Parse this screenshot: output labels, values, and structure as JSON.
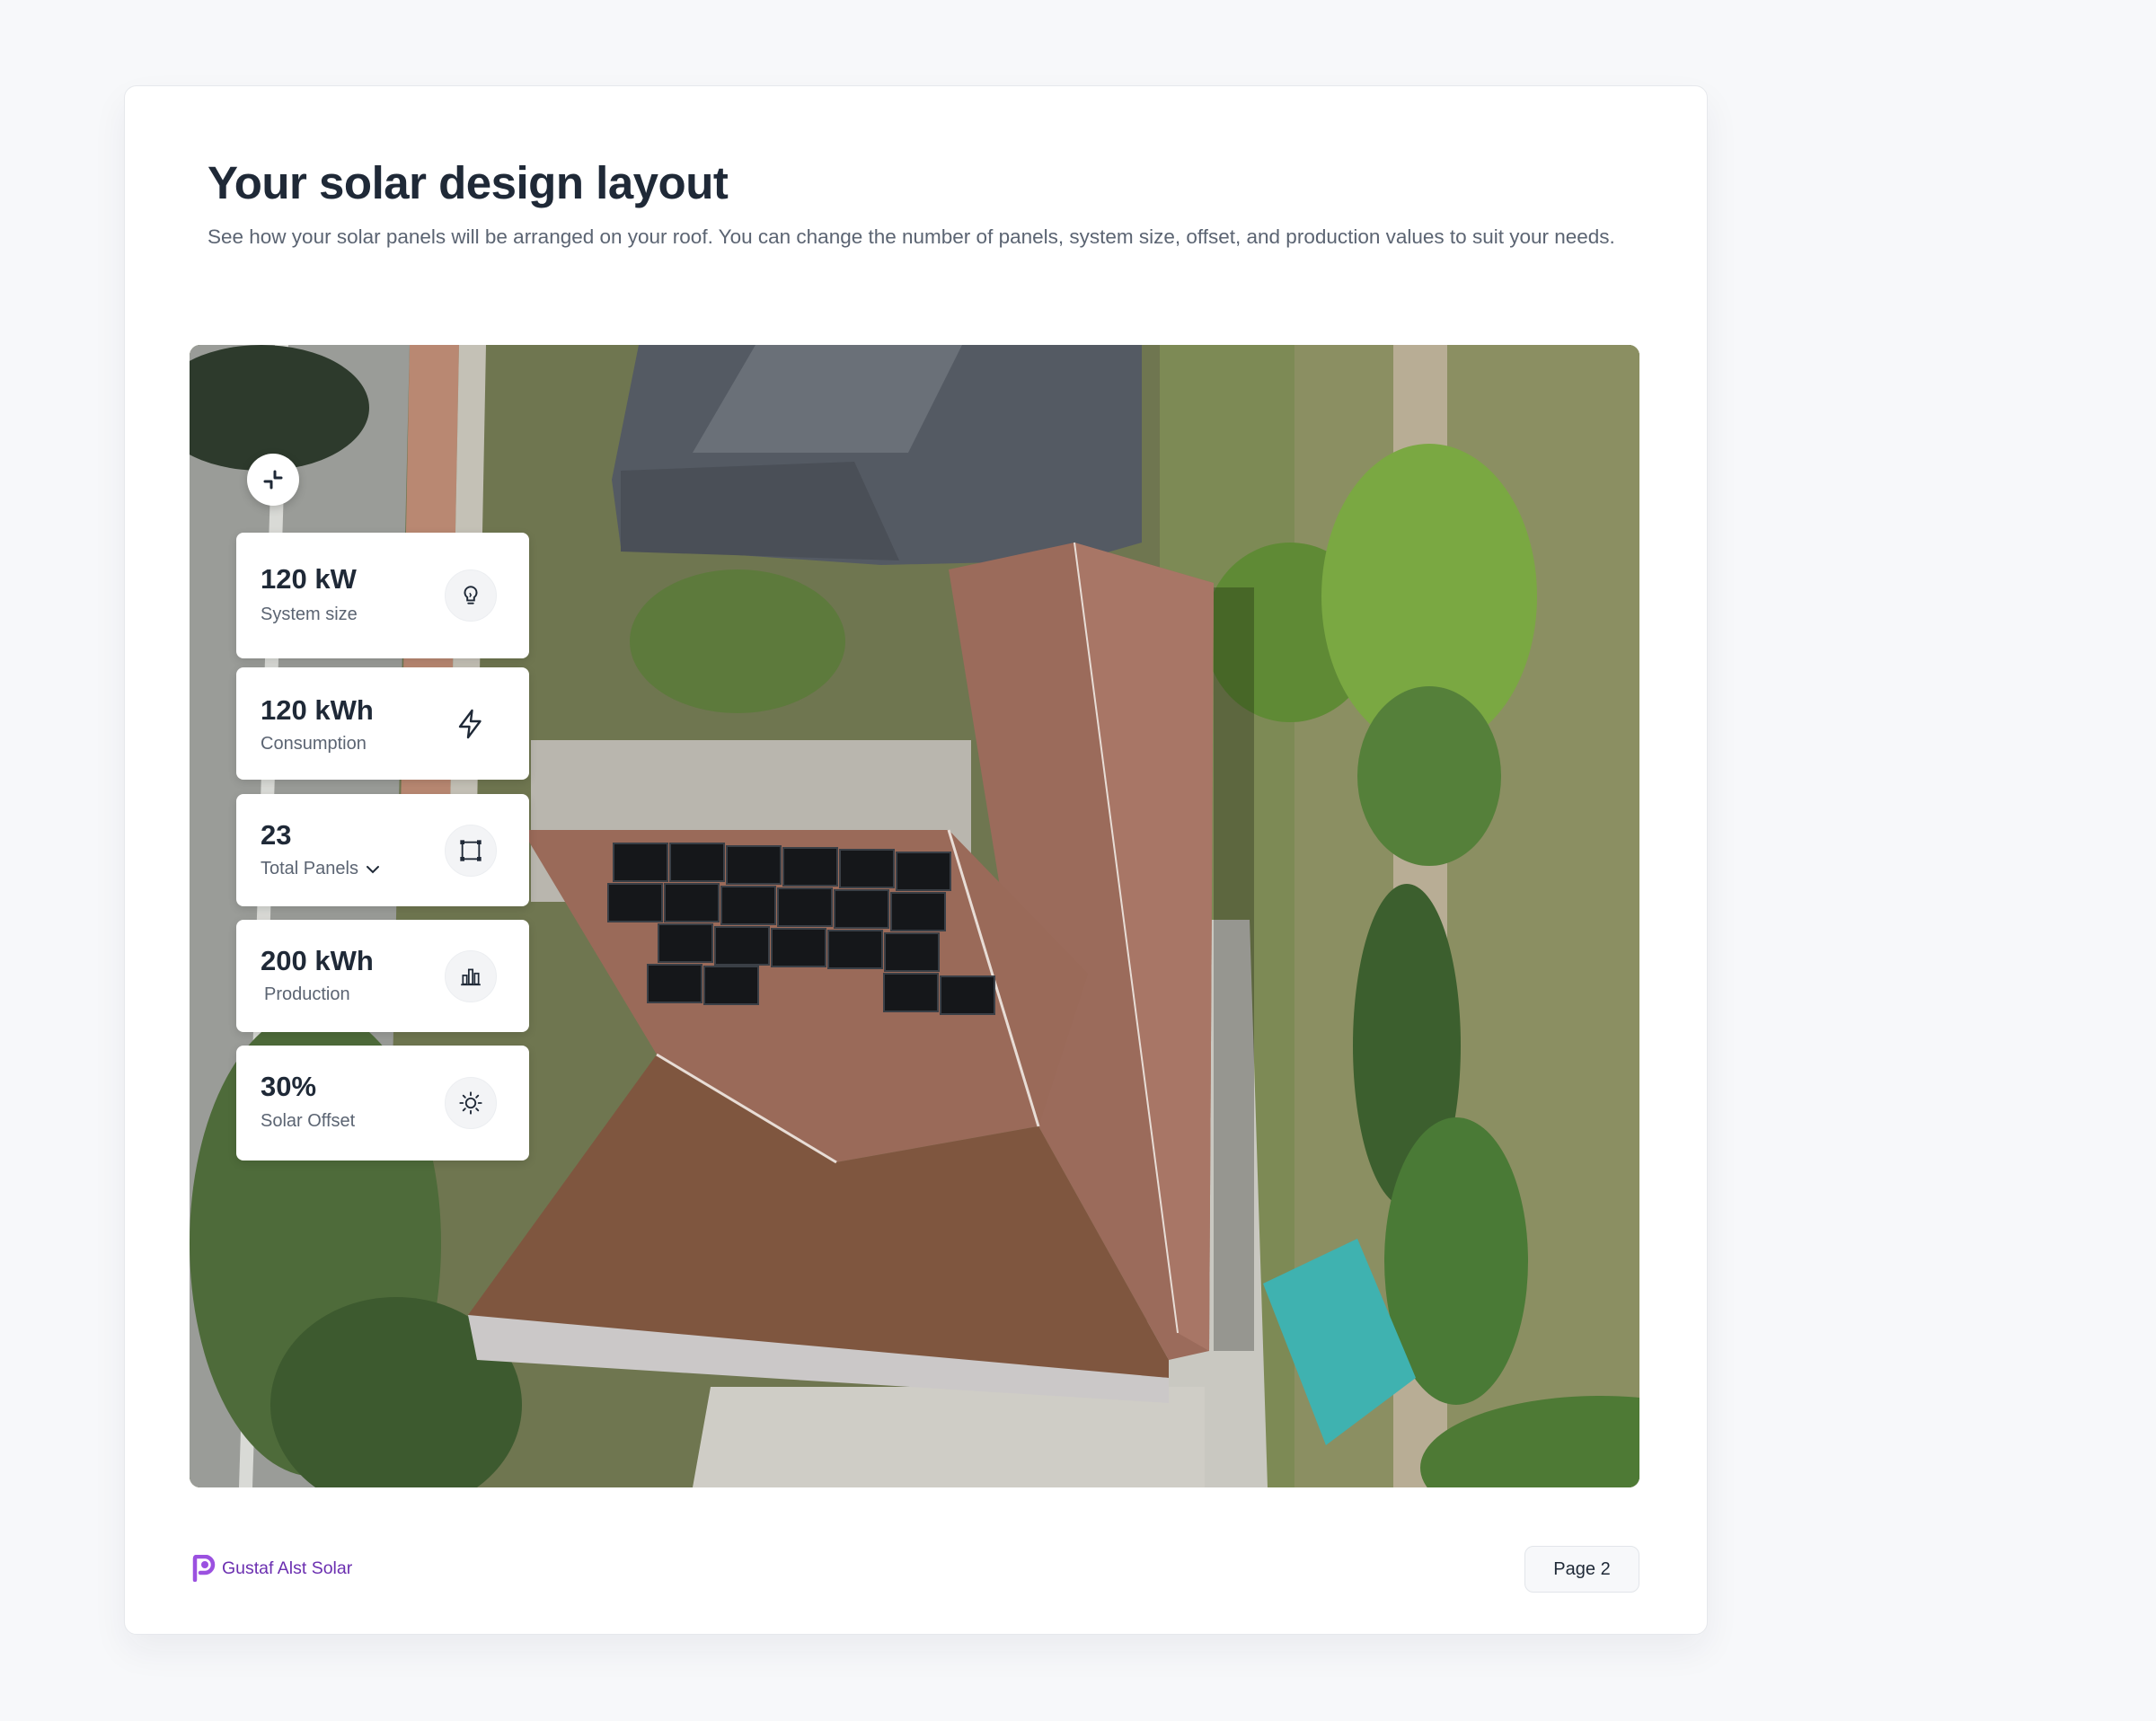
{
  "header": {
    "title": "Your solar design layout",
    "subtitle": "See how your solar panels will be arranged on your roof. You can change the number of panels, system size, offset, and production values to suit your needs."
  },
  "map": {
    "collapse_icon": "collapse-arrows-icon",
    "stats": [
      {
        "value": "120 kW",
        "label": "System size",
        "icon": "lightbulb-icon"
      },
      {
        "value": "120 kWh",
        "label": "Consumption",
        "icon": "lightning-bolt-icon"
      },
      {
        "value": "23",
        "label": "Total Panels",
        "icon": "panel-frame-icon",
        "has_dropdown": true
      },
      {
        "value": "200 kWh",
        "label": "Production",
        "icon": "bar-chart-icon"
      },
      {
        "value": "30%",
        "label": "Solar Offset",
        "icon": "sun-icon"
      }
    ]
  },
  "footer": {
    "brand": "Gustaf Alst Solar",
    "brand_color": "#6b2fb0",
    "page": "Page 2"
  }
}
